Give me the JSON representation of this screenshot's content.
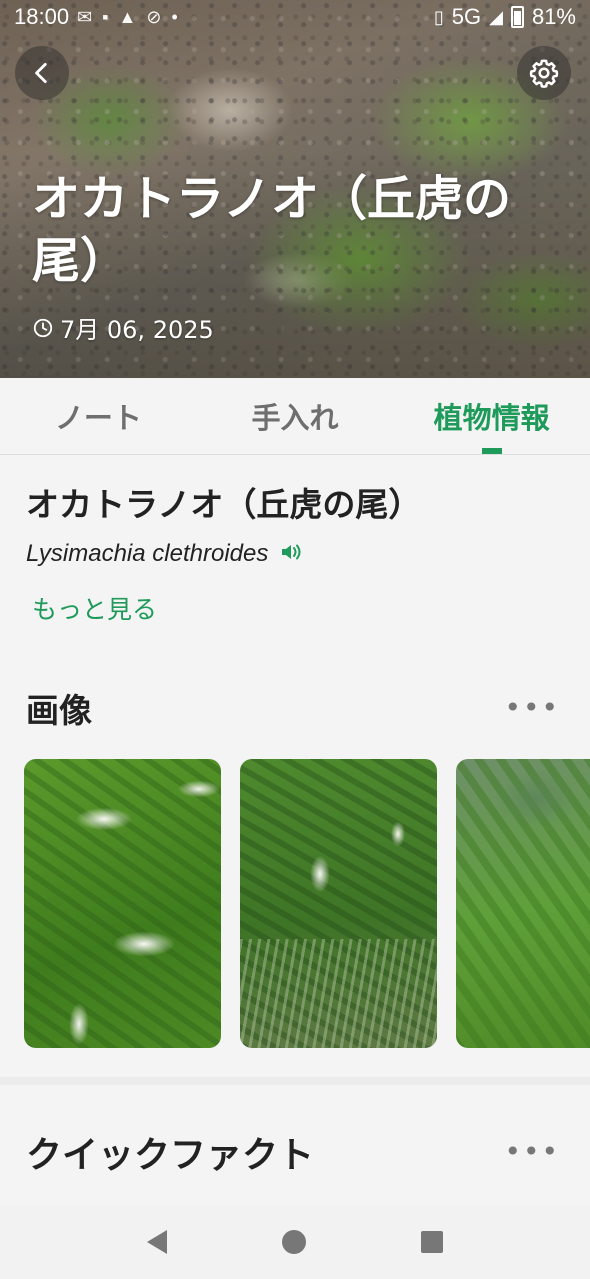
{
  "status_bar": {
    "time": "18:00",
    "network": "5G",
    "battery": "81%"
  },
  "hero": {
    "title": "オカトラノオ（丘虎の尾）",
    "date": "7月 06, 2025"
  },
  "tabs": [
    {
      "label": "ノート",
      "active": false
    },
    {
      "label": "手入れ",
      "active": false
    },
    {
      "label": "植物情報",
      "active": true
    }
  ],
  "plant": {
    "name": "オカトラノオ（丘虎の尾）",
    "scientific_name": "Lysimachia clethroides",
    "more_link": "もっと見る"
  },
  "images_section": {
    "title": "画像",
    "more": "•••"
  },
  "quick_facts": {
    "title": "クイックファクト",
    "more": "•••"
  },
  "colors": {
    "accent": "#1e9a5a",
    "background": "#f4f4f4",
    "text": "#222222"
  },
  "icons": {
    "back": "chevron-left-icon",
    "settings": "gear-icon",
    "date": "clock-icon",
    "audio": "speaker-icon"
  }
}
